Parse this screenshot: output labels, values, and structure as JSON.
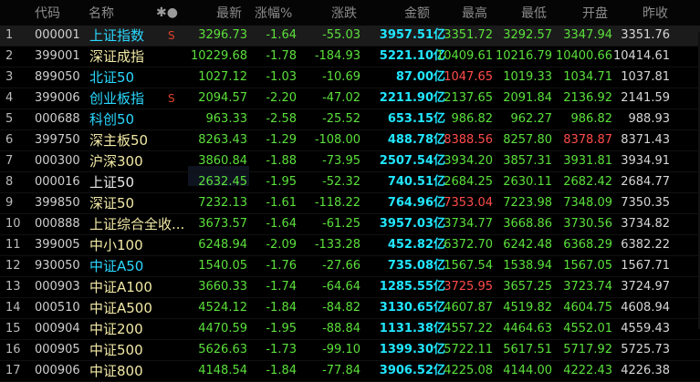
{
  "header": {
    "col_idx": "",
    "col_code": "代码",
    "col_name": "名称",
    "col_star": "✱●",
    "col_price": "最新",
    "col_pct": "涨幅%",
    "col_chg": "涨跌",
    "col_amt": "金额",
    "col_high": "最高",
    "col_low": "最低",
    "col_open": "开盘",
    "col_prev": "昨收"
  },
  "rows": [
    {
      "idx": "1",
      "code": "000001",
      "name": "上证指数",
      "flag": "S",
      "price": "3296.73",
      "pct": "-1.64",
      "chg": "-55.03",
      "amt": "3957.51亿",
      "high": "3351.72",
      "low": "3292.57",
      "open": "3347.94",
      "prev": "3351.76"
    },
    {
      "idx": "2",
      "code": "399001",
      "name": "深证成指",
      "flag": "",
      "price": "10229.68",
      "pct": "-1.78",
      "chg": "-184.93",
      "amt": "5221.10亿",
      "high": "10409.61",
      "low": "10216.79",
      "open": "10400.66",
      "prev": "10414.61"
    },
    {
      "idx": "3",
      "code": "899050",
      "name": "北证50",
      "flag": "",
      "price": "1027.12",
      "pct": "-1.03",
      "chg": "-10.69",
      "amt": "87.00亿",
      "high": "1047.65",
      "low": "1019.33",
      "open": "1034.71",
      "prev": "1037.81"
    },
    {
      "idx": "4",
      "code": "399006",
      "name": "创业板指",
      "flag": "S",
      "price": "2094.57",
      "pct": "-2.20",
      "chg": "-47.02",
      "amt": "2211.90亿",
      "high": "2137.65",
      "low": "2091.84",
      "open": "2136.92",
      "prev": "2141.59"
    },
    {
      "idx": "5",
      "code": "000688",
      "name": "科创50",
      "flag": "",
      "price": "963.33",
      "pct": "-2.58",
      "chg": "-25.52",
      "amt": "653.15亿",
      "high": "986.82",
      "low": "962.27",
      "open": "986.82",
      "prev": "988.93"
    },
    {
      "idx": "6",
      "code": "399750",
      "name": "深主板50",
      "flag": "",
      "price": "8263.43",
      "pct": "-1.29",
      "chg": "-108.00",
      "amt": "488.78亿",
      "high": "8388.56",
      "low": "8257.80",
      "open": "8378.87",
      "prev": "8371.43"
    },
    {
      "idx": "7",
      "code": "000300",
      "name": "沪深300",
      "flag": "",
      "price": "3860.84",
      "pct": "-1.88",
      "chg": "-73.95",
      "amt": "2507.54亿",
      "high": "3934.20",
      "low": "3857.31",
      "open": "3931.81",
      "prev": "3934.91"
    },
    {
      "idx": "8",
      "code": "000016",
      "name": "上证50",
      "flag": "",
      "price": "2632.45",
      "pct": "-1.95",
      "chg": "-52.32",
      "amt": "740.51亿",
      "high": "2684.25",
      "low": "2630.11",
      "open": "2682.42",
      "prev": "2684.77"
    },
    {
      "idx": "9",
      "code": "399850",
      "name": "深证50",
      "flag": "",
      "price": "7232.13",
      "pct": "-1.61",
      "chg": "-118.22",
      "amt": "764.96亿",
      "high": "7353.04",
      "low": "7223.98",
      "open": "7348.09",
      "prev": "7350.35"
    },
    {
      "idx": "10",
      "code": "000888",
      "name": "上证综合全收...",
      "flag": "",
      "price": "3673.57",
      "pct": "-1.64",
      "chg": "-61.25",
      "amt": "3957.03亿",
      "high": "3734.77",
      "low": "3668.86",
      "open": "3730.56",
      "prev": "3734.82"
    },
    {
      "idx": "11",
      "code": "399005",
      "name": "中小100",
      "flag": "",
      "price": "6248.94",
      "pct": "-2.09",
      "chg": "-133.28",
      "amt": "452.82亿",
      "high": "6372.70",
      "low": "6242.48",
      "open": "6368.29",
      "prev": "6382.22"
    },
    {
      "idx": "12",
      "code": "930050",
      "name": "中证A50",
      "flag": "",
      "price": "1540.05",
      "pct": "-1.76",
      "chg": "-27.66",
      "amt": "735.08亿",
      "high": "1567.54",
      "low": "1538.94",
      "open": "1567.05",
      "prev": "1567.71"
    },
    {
      "idx": "13",
      "code": "000903",
      "name": "中证A100",
      "flag": "",
      "price": "3660.33",
      "pct": "-1.74",
      "chg": "-64.64",
      "amt": "1285.55亿",
      "high": "3725.95",
      "low": "3657.25",
      "open": "3723.74",
      "prev": "3724.97"
    },
    {
      "idx": "14",
      "code": "000510",
      "name": "中证A500",
      "flag": "",
      "price": "4524.12",
      "pct": "-1.84",
      "chg": "-84.82",
      "amt": "3130.65亿",
      "high": "4607.87",
      "low": "4519.82",
      "open": "4604.75",
      "prev": "4608.94"
    },
    {
      "idx": "15",
      "code": "000904",
      "name": "中证200",
      "flag": "",
      "price": "4470.59",
      "pct": "-1.95",
      "chg": "-88.84",
      "amt": "1131.38亿",
      "high": "4557.22",
      "low": "4464.63",
      "open": "4552.01",
      "prev": "4559.43"
    },
    {
      "idx": "16",
      "code": "000905",
      "name": "中证500",
      "flag": "",
      "price": "5626.63",
      "pct": "-1.73",
      "chg": "-99.10",
      "amt": "1399.30亿",
      "high": "5722.11",
      "low": "5617.51",
      "open": "5717.92",
      "prev": "5725.73"
    },
    {
      "idx": "17",
      "code": "000906",
      "name": "中证800",
      "flag": "",
      "price": "4148.54",
      "pct": "-1.84",
      "chg": "-77.84",
      "amt": "3906.52亿",
      "high": "4225.08",
      "low": "4144.00",
      "open": "4222.43",
      "prev": "4226.38"
    }
  ],
  "colors": {
    "down": "#5be03b",
    "up": "#ff4b4b",
    "amount": "#21e6ff"
  }
}
